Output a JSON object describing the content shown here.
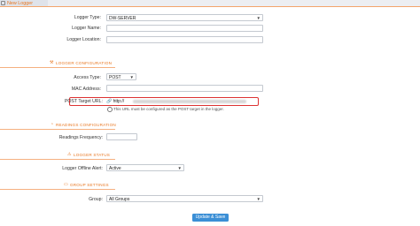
{
  "header": {
    "title": "New Logger"
  },
  "logger": {
    "type_label": "Logger Type:",
    "type_value": "DW-SERVER",
    "name_label": "Logger Name:",
    "name_value": "",
    "location_label": "Logger Location:",
    "location_value": ""
  },
  "sections": {
    "logger_configuration": "LOGGER CONFIGURATION",
    "readings_configuration": "READINGS CONFIGURATION",
    "logger_status": "LOGGER STATUS",
    "group_settings": "GROUP SETTINGS"
  },
  "config": {
    "access_type_label": "Access Type:",
    "access_type_value": "POST",
    "mac_label": "MAC Address:",
    "mac_value": "",
    "post_url_label": "POST Target URL:",
    "post_url_value": "http://",
    "post_url_hint": "This URL must be configured as the POST target in the logger."
  },
  "readings": {
    "frequency_label": "Readings Frequency:",
    "frequency_value": ""
  },
  "status": {
    "offline_alert_label": "Logger Offline Alert:",
    "offline_alert_value": "Active"
  },
  "groups": {
    "group_label": "Group:",
    "group_value": "All Groups"
  },
  "actions": {
    "update_save": "Update & Save"
  }
}
